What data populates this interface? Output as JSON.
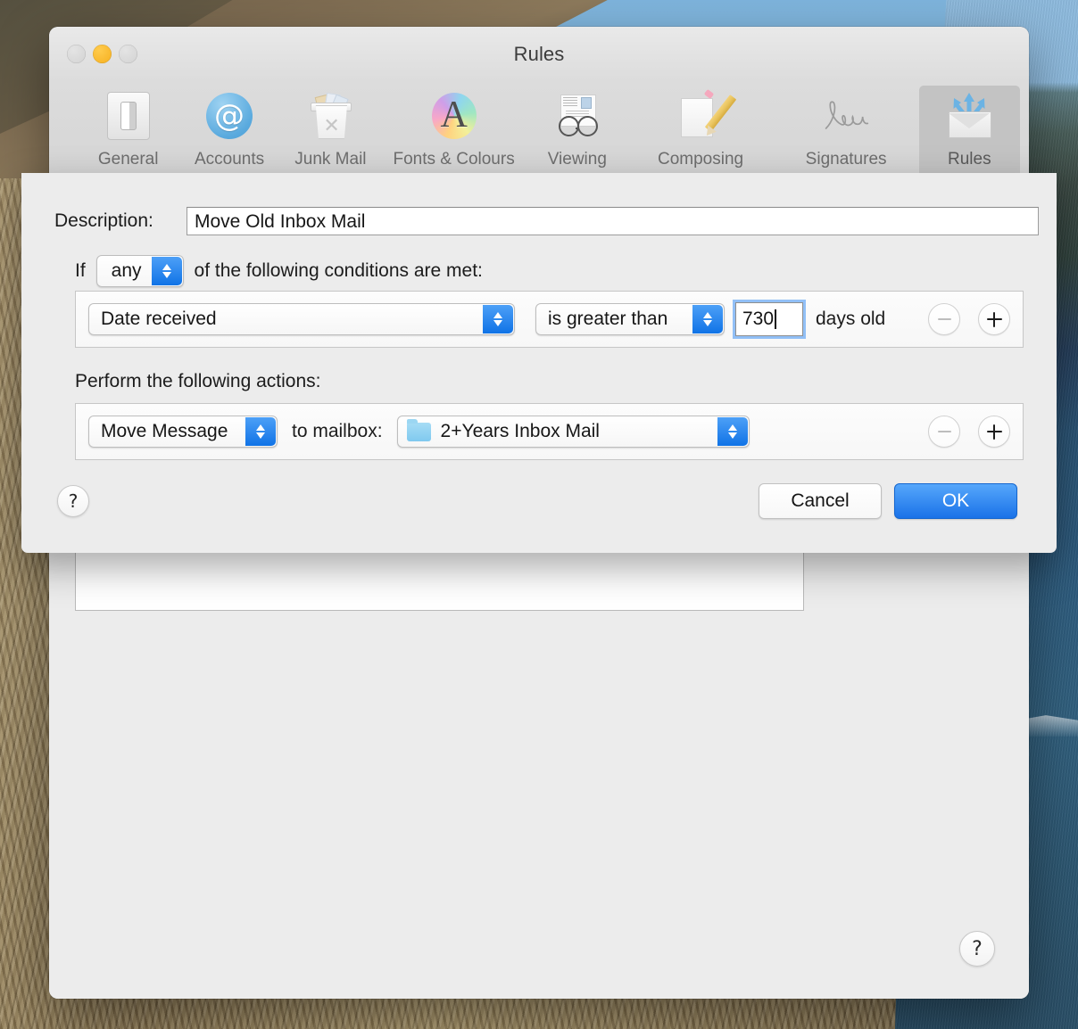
{
  "window": {
    "title": "Rules",
    "traffic_lights": [
      "close",
      "minimize",
      "zoom"
    ]
  },
  "toolbar": {
    "items": [
      {
        "label": "General",
        "icon": "switch-icon",
        "selected": false
      },
      {
        "label": "Accounts",
        "icon": "at-sign-icon",
        "selected": false
      },
      {
        "label": "Junk Mail",
        "icon": "trash-can-icon",
        "selected": false
      },
      {
        "label": "Fonts & Colours",
        "icon": "font-palette-icon",
        "selected": false
      },
      {
        "label": "Viewing",
        "icon": "glasses-icon",
        "selected": false
      },
      {
        "label": "Composing",
        "icon": "pencil-page-icon",
        "selected": false
      },
      {
        "label": "Signatures",
        "icon": "signature-icon",
        "selected": false
      },
      {
        "label": "Rules",
        "icon": "rules-envelope-icon",
        "selected": true
      }
    ]
  },
  "prefs_body": {
    "help_button_label": "?"
  },
  "sheet": {
    "description": {
      "label": "Description:",
      "value": "Move Old Inbox Mail",
      "placeholder": ""
    },
    "if_row": {
      "prefix": "If",
      "match_value": "any",
      "suffix": "of the following conditions are met:"
    },
    "conditions": [
      {
        "criterion": "Date received",
        "operator": "is greater than",
        "value": "730",
        "unit": "days old",
        "remove_enabled": false,
        "add_enabled": true
      }
    ],
    "actions_label": "Perform the following actions:",
    "actions": [
      {
        "type": "Move Message",
        "connector": "to mailbox:",
        "mailbox": "2+Years Inbox Mail",
        "mailbox_icon": "folder-icon",
        "remove_enabled": false,
        "add_enabled": true
      }
    ],
    "footer": {
      "help_label": "?",
      "cancel_label": "Cancel",
      "ok_label": "OK"
    }
  },
  "colors": {
    "accent_blue": "#1a72e8",
    "stepper_blue": "#1073e6",
    "focus_ring": "#4696f5",
    "window_chrome": "#ececec",
    "toolbar_selected": "#c3c3c3"
  }
}
